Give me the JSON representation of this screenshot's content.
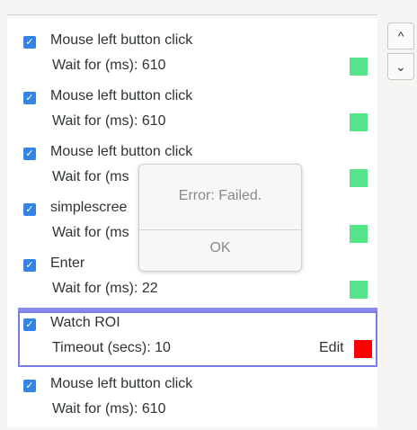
{
  "scroll": {
    "up_icon": "chevron-up-icon",
    "down_icon": "chevron-down-icon",
    "up_glyph": "^",
    "down_glyph": "⌄"
  },
  "rows": [
    {
      "title": "Mouse left button click",
      "meta": "Wait for (ms): 610",
      "status": "green"
    },
    {
      "title": "Mouse left button click",
      "meta": "Wait for (ms): 610",
      "status": "green"
    },
    {
      "title": "Mouse left button click",
      "meta": "Wait for (ms",
      "status": "green"
    },
    {
      "title": "simplescree",
      "meta": "Wait for (ms",
      "status": "green"
    },
    {
      "title": "Enter",
      "meta": "Wait for (ms): 22",
      "status": "green"
    },
    {
      "title": "Watch ROI",
      "meta": "Timeout (secs): 10",
      "edit": "Edit",
      "status": "red",
      "selected": true
    },
    {
      "title": "Mouse left button click",
      "meta": "Wait for (ms): 610"
    }
  ],
  "dialog": {
    "message": "Error: Failed.",
    "ok": "OK"
  },
  "colors": {
    "checkbox": "#3584e4",
    "status_green": "#57e389",
    "status_red": "#ff0000",
    "selection": "#7d7dea"
  }
}
